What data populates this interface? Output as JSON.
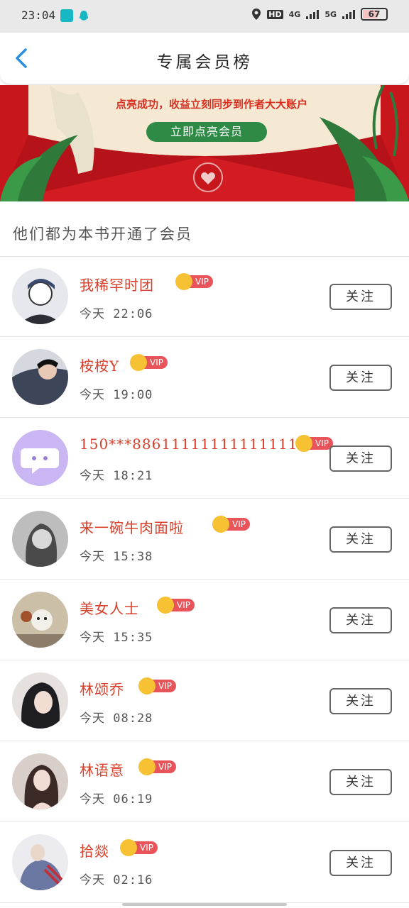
{
  "status_bar": {
    "time": "23:04",
    "network_1": "4G",
    "network_2": "5G",
    "hd_label": "HD",
    "battery": "67"
  },
  "header": {
    "title": "专属会员榜"
  },
  "banner": {
    "text": "点亮成功，收益立刻同步到作者大大账户",
    "button_label": "立即点亮会员"
  },
  "section": {
    "title": "他们都为本书开通了会员"
  },
  "vip_label": "VIP",
  "follow_label": "关注",
  "members": [
    {
      "name": "我稀罕时团",
      "time": "今天 22:06",
      "avatar_color": "#4a4f68"
    },
    {
      "name": "桉桉Y",
      "time": "今天 19:00",
      "avatar_color": "#3d4658"
    },
    {
      "name": "150***886111111111111111",
      "time": "今天 18:21",
      "avatar_color": "#c9b6f3"
    },
    {
      "name": "来一碗牛肉面啦",
      "time": "今天 15:38",
      "avatar_color": "#6e6e6e"
    },
    {
      "name": "美女人士",
      "time": "今天 15:35",
      "avatar_color": "#a89880"
    },
    {
      "name": "林颂乔",
      "time": "今天 08:28",
      "avatar_color": "#2f2f34"
    },
    {
      "name": "林语意",
      "time": "今天 06:19",
      "avatar_color": "#b3a7a4"
    },
    {
      "name": "拾燚",
      "time": "今天 02:16",
      "avatar_color": "#7a84a8"
    }
  ],
  "colors": {
    "accent_red": "#d8402c",
    "vip_badge": "#e9545a",
    "vip_crown": "#f6c233",
    "banner_bg": "#c8161d",
    "banner_button": "#2e8a45"
  }
}
